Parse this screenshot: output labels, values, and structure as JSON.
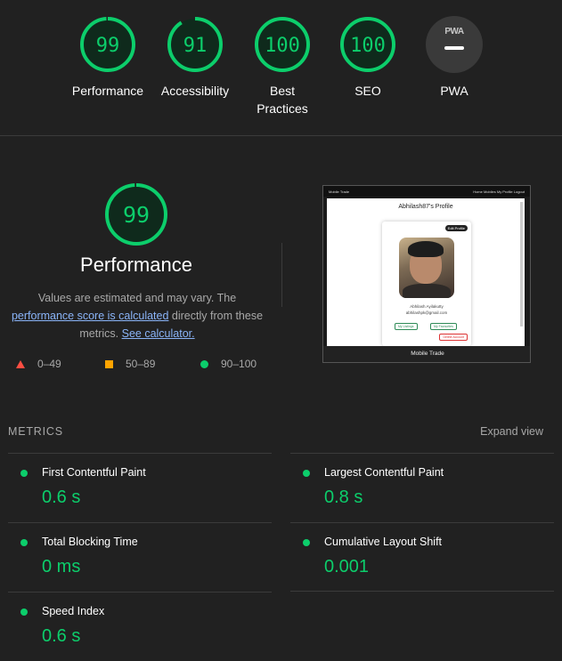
{
  "gauges": [
    {
      "score": "99",
      "label": "Performance",
      "value": 0.99,
      "color": "#0cce6b"
    },
    {
      "score": "91",
      "label": "Accessibility",
      "value": 0.91,
      "color": "#0cce6b"
    },
    {
      "score": "100",
      "label": "Best Practices",
      "value": 1.0,
      "color": "#0cce6b"
    },
    {
      "score": "100",
      "label": "SEO",
      "value": 1.0,
      "color": "#0cce6b"
    }
  ],
  "pwa": {
    "badge": "PWA",
    "label": "PWA"
  },
  "performance": {
    "score": "99",
    "value": 0.99,
    "title": "Performance",
    "desc_1": "Values are estimated and may vary. The ",
    "link_1": "performance score is calculated",
    "desc_2": " directly from these metrics. ",
    "link_2": "See calculator.",
    "legend": {
      "fail": "0–49",
      "average": "50–89",
      "pass": "90–100"
    }
  },
  "screenshot": {
    "brand": "Mobile Trade",
    "nav_links": "Home  Mobiles  My Profile  Logout",
    "heading": "Abhilash87's Profile",
    "edit_button": "Edit Profile",
    "name": "Abhilash Ayilakutty",
    "email": "abhilashpk@gmail.com",
    "btn_listings": "My Listings",
    "btn_favourites": "My Favourites",
    "btn_delete": "Delete Account",
    "footer": "Mobile Trade"
  },
  "metrics": {
    "heading": "METRICS",
    "expand": "Expand view",
    "items": [
      {
        "label": "First Contentful Paint",
        "value": "0.6 s"
      },
      {
        "label": "Largest Contentful Paint",
        "value": "0.8 s"
      },
      {
        "label": "Total Blocking Time",
        "value": "0 ms"
      },
      {
        "label": "Cumulative Layout Shift",
        "value": "0.001"
      },
      {
        "label": "Speed Index",
        "value": "0.6 s"
      }
    ]
  },
  "colors": {
    "pass": "#0cce6b",
    "average": "#ffa400",
    "fail": "#ff4e42",
    "background": "#212121"
  }
}
